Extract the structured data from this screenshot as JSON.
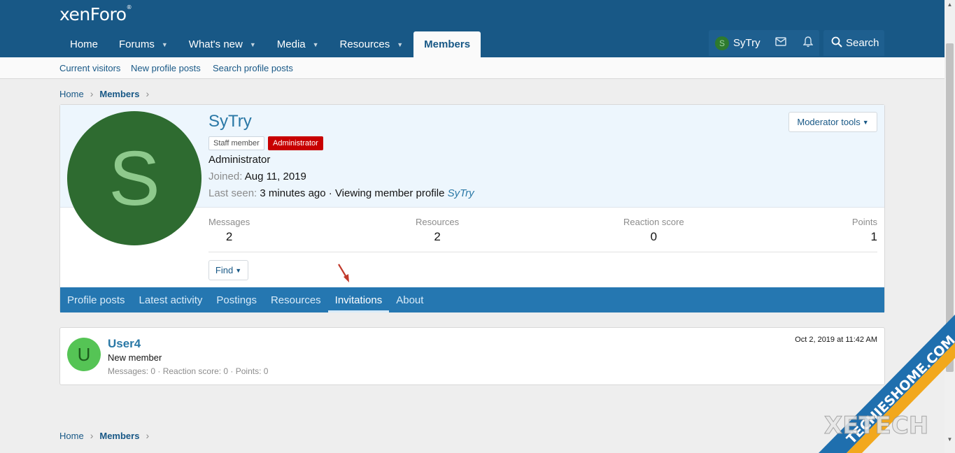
{
  "header": {
    "logo": "xenForo",
    "logo_mark": "®",
    "nav": [
      {
        "label": "Home",
        "dropdown": false
      },
      {
        "label": "Forums",
        "dropdown": true
      },
      {
        "label": "What's new",
        "dropdown": true
      },
      {
        "label": "Media",
        "dropdown": true
      },
      {
        "label": "Resources",
        "dropdown": true
      },
      {
        "label": "Members",
        "dropdown": false,
        "active": true
      }
    ],
    "user": {
      "initial": "S",
      "name": "SyTry"
    },
    "search_label": "Search"
  },
  "subnav": [
    "Current visitors",
    "New profile posts",
    "Search profile posts"
  ],
  "breadcrumb": {
    "home": "Home",
    "current": "Members"
  },
  "profile": {
    "avatar_initial": "S",
    "username": "SyTry",
    "badges": {
      "staff": "Staff member",
      "admin": "Administrator"
    },
    "user_title": "Administrator",
    "joined_label": "Joined:",
    "joined_value": "Aug 11, 2019",
    "last_seen_label": "Last seen:",
    "last_seen_value": "3 minutes ago · Viewing member profile",
    "last_seen_link": "SyTry",
    "moderator_tools": "Moderator tools",
    "stats": [
      {
        "label": "Messages",
        "value": "2"
      },
      {
        "label": "Resources",
        "value": "2"
      },
      {
        "label": "Reaction score",
        "value": "0"
      },
      {
        "label": "Points",
        "value": "1"
      }
    ],
    "find_label": "Find",
    "tabs": [
      "Profile posts",
      "Latest activity",
      "Postings",
      "Resources",
      "Invitations",
      "About"
    ],
    "active_tab": "Invitations"
  },
  "invitation": {
    "avatar_initial": "U",
    "name": "User4",
    "title": "New member",
    "stats": "Messages: 0 · Reaction score: 0 · Points: 0",
    "date": "Oct 2, 2019 at 11:42 AM"
  },
  "watermark": {
    "text1": "TECHIESHOME.COM",
    "text2": "XETECH"
  },
  "colors": {
    "header": "#185886",
    "tabs": "#2577b1",
    "admin_badge": "#c80000",
    "avatar": "#2e6b30"
  }
}
